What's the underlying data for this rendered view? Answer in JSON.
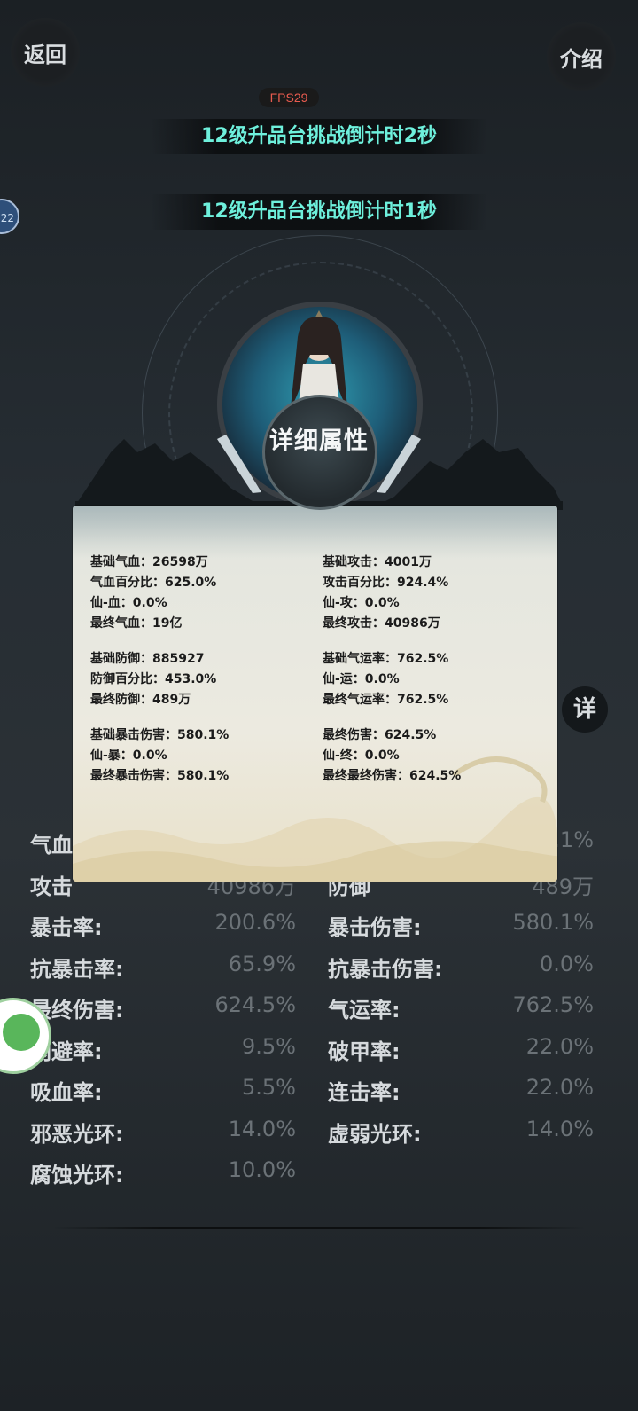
{
  "header": {
    "back_label": "返回",
    "intro_label": "介绍",
    "fps": "FPS29"
  },
  "countdowns": [
    "12级升品台挑战倒计时2秒",
    "12级升品台挑战倒计时1秒"
  ],
  "level_badge": "22",
  "panel": {
    "title": "详细属性",
    "left_groups": [
      [
        "基础气血：26598万",
        "气血百分比：625.0%",
        "仙-血：0.0%",
        "最终气血：19亿"
      ],
      [
        "基础防御：885927",
        "防御百分比：453.0%",
        "最终防御：489万"
      ],
      [
        "基础暴击伤害：580.1%",
        "仙-暴：0.0%",
        "最终暴击伤害：580.1%"
      ]
    ],
    "right_groups": [
      [
        "基础攻击：4001万",
        "攻击百分比：924.4%",
        "仙-攻：0.0%",
        "最终攻击：40986万"
      ],
      [
        "基础气运率：762.5%",
        "仙-运：0.0%",
        "最终气运率：762.5%"
      ],
      [
        "最终伤害：624.5%",
        "仙-终：0.0%",
        "最终最终伤害：624.5%"
      ]
    ]
  },
  "detail_button": "详",
  "stats": {
    "row1": {
      "left_label": "气血",
      "right_value": ".1%"
    },
    "row2": {
      "left_label": "攻击",
      "left_value": "40986万",
      "right_label": "防御",
      "right_value": "489万"
    },
    "rows": [
      {
        "left_label": "暴击率:",
        "left_value": "200.6%",
        "right_label": "暴击伤害:",
        "right_value": "580.1%"
      },
      {
        "left_label": "抗暴击率:",
        "left_value": "65.9%",
        "right_label": "抗暴击伤害:",
        "right_value": "0.0%"
      },
      {
        "left_label": "最终伤害:",
        "left_value": "624.5%",
        "right_label": "气运率:",
        "right_value": "762.5%"
      },
      {
        "left_label": "闪避率:",
        "left_value": "9.5%",
        "right_label": "破甲率:",
        "right_value": "22.0%"
      },
      {
        "left_label": "吸血率:",
        "left_value": "5.5%",
        "right_label": "连击率:",
        "right_value": "22.0%"
      },
      {
        "left_label": "邪恶光环:",
        "left_value": "14.0%",
        "right_label": "虚弱光环:",
        "right_value": "14.0%"
      },
      {
        "left_label": "腐蚀光环:",
        "left_value": "10.0%"
      }
    ]
  }
}
